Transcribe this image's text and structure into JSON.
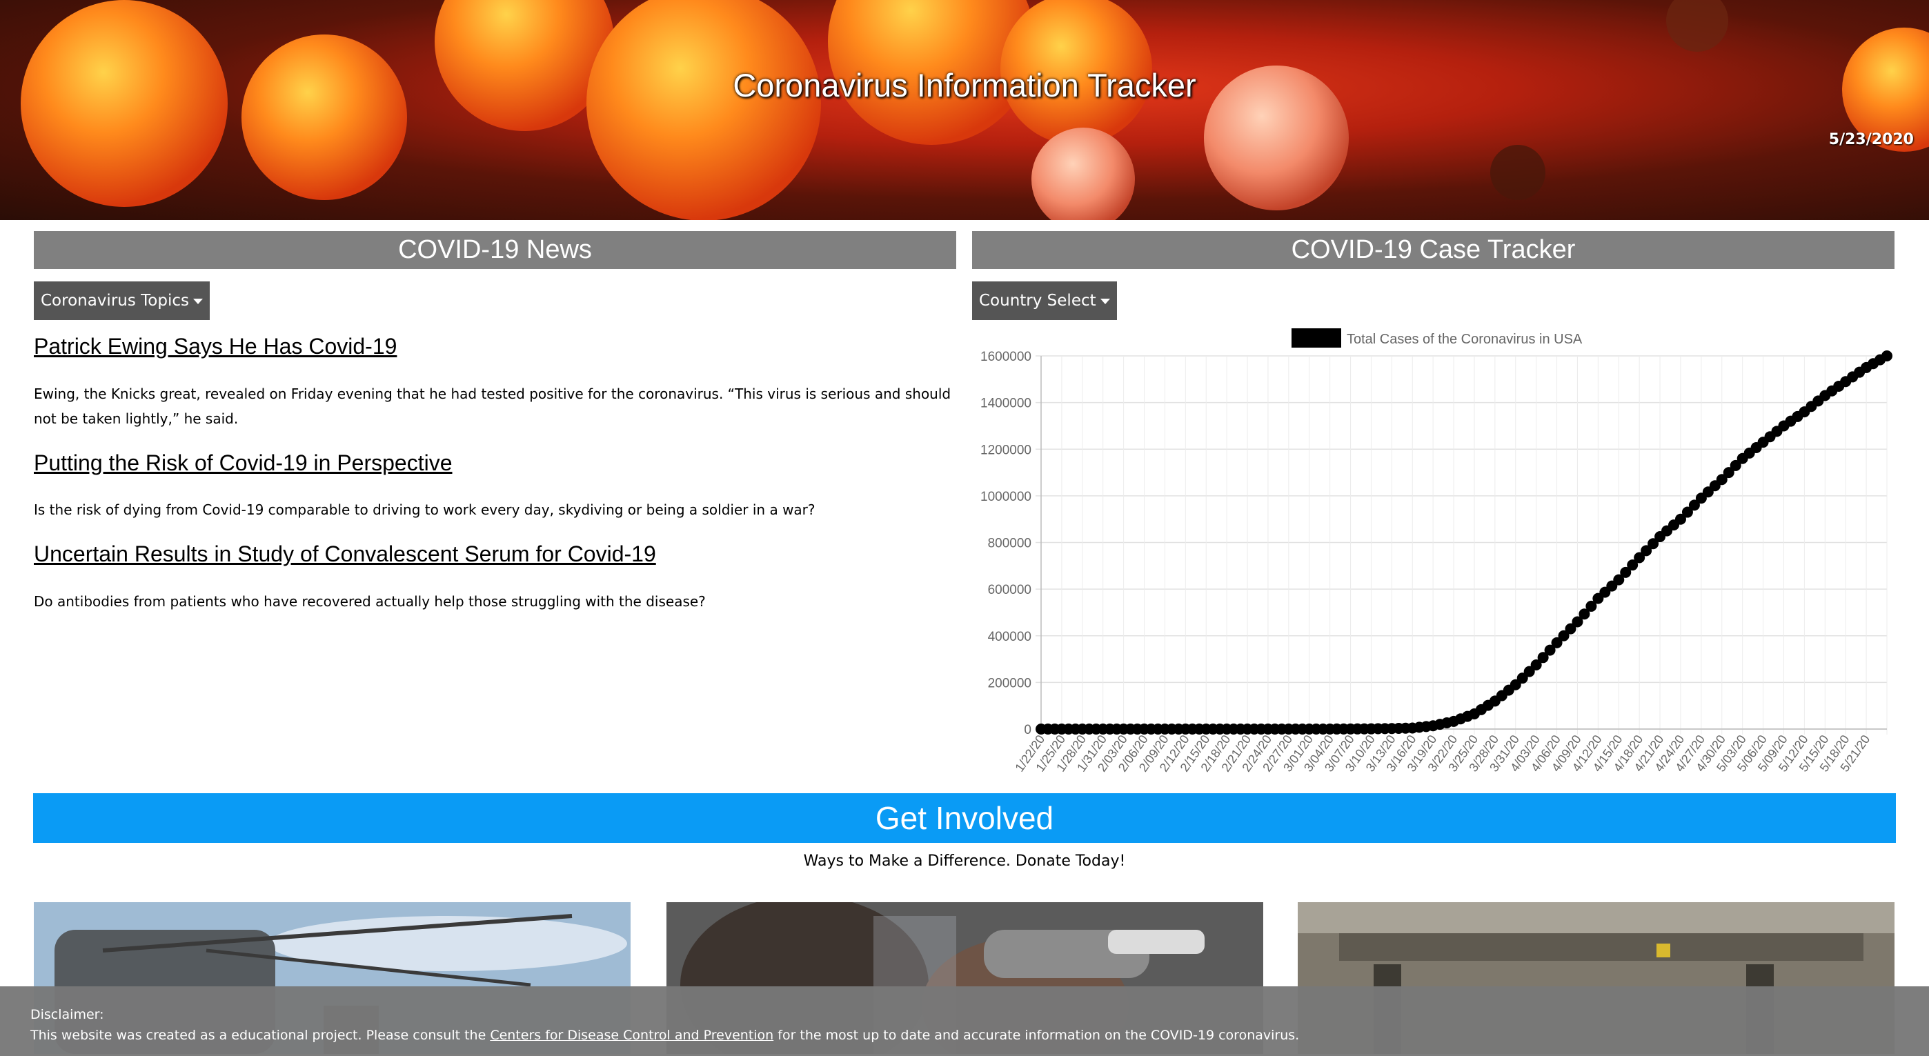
{
  "header": {
    "title": "Coronavirus Information Tracker",
    "date": "5/23/2020"
  },
  "news": {
    "heading": "COVID-19 News",
    "dropdown_label": "Coronavirus Topics",
    "articles": [
      {
        "title": "Patrick Ewing Says He Has Covid-19",
        "description": "Ewing, the Knicks great, revealed on Friday evening that he had tested positive for the coronavirus. “This virus is serious and should not be taken lightly,” he said."
      },
      {
        "title": "Putting the Risk of Covid-19 in Perspective",
        "description": "Is the risk of dying from Covid-19 comparable to driving to work every day, skydiving or being a soldier in a war?"
      },
      {
        "title": "Uncertain Results in Study of Convalescent Serum for Covid-19",
        "description": "Do antibodies from patients who have recovered actually help those struggling with the disease?"
      }
    ]
  },
  "tracker": {
    "heading": "COVID-19 Case Tracker",
    "dropdown_label": "Country Select"
  },
  "chart_data": {
    "type": "line",
    "legend": "Total Cases of the Coronavirus in USA",
    "legend_position": "top",
    "series_color": "#000000",
    "grid": true,
    "ylim": [
      0,
      1600000
    ],
    "yticks": [
      0,
      200000,
      400000,
      600000,
      800000,
      1000000,
      1200000,
      1400000,
      1600000
    ],
    "ytick_labels": [
      "0",
      "200000",
      "400000",
      "600000",
      "800000",
      "1000000",
      "1200000",
      "1400000",
      "1600000"
    ],
    "xtick_labels": [
      "1/22/20",
      "1/25/20",
      "1/28/20",
      "1/31/20",
      "2/03/20",
      "2/06/20",
      "2/09/20",
      "2/12/20",
      "2/15/20",
      "2/18/20",
      "2/21/20",
      "2/24/20",
      "2/27/20",
      "3/01/20",
      "3/04/20",
      "3/07/20",
      "3/10/20",
      "3/13/20",
      "3/16/20",
      "3/19/20",
      "3/22/20",
      "3/25/20",
      "3/28/20",
      "3/31/20",
      "4/03/20",
      "4/06/20",
      "4/09/20",
      "4/12/20",
      "4/15/20",
      "4/18/20",
      "4/21/20",
      "4/24/20",
      "4/27/20",
      "4/30/20",
      "5/03/20",
      "5/06/20",
      "5/09/20",
      "5/12/20",
      "5/15/20",
      "5/18/20",
      "5/21/20"
    ],
    "x": [
      "1/22/20",
      "1/25/20",
      "1/28/20",
      "1/31/20",
      "2/03/20",
      "2/06/20",
      "2/09/20",
      "2/12/20",
      "2/15/20",
      "2/18/20",
      "2/21/20",
      "2/24/20",
      "2/27/20",
      "3/01/20",
      "3/04/20",
      "3/07/20",
      "3/10/20",
      "3/13/20",
      "3/16/20",
      "3/19/20",
      "3/22/20",
      "3/25/20",
      "3/28/20",
      "3/31/20",
      "4/03/20",
      "4/06/20",
      "4/09/20",
      "4/12/20",
      "4/15/20",
      "4/18/20",
      "4/21/20",
      "4/24/20",
      "4/27/20",
      "4/30/20",
      "5/03/20",
      "5/06/20",
      "5/09/20",
      "5/12/20",
      "5/15/20",
      "5/18/20",
      "5/21/20",
      "5/22/20"
    ],
    "values": [
      1,
      5,
      5,
      6,
      11,
      11,
      11,
      13,
      13,
      13,
      15,
      15,
      16,
      30,
      150,
      400,
      1000,
      2200,
      4600,
      14000,
      33000,
      65000,
      120000,
      190000,
      275000,
      370000,
      460000,
      560000,
      640000,
      735000,
      825000,
      900000,
      990000,
      1070000,
      1160000,
      1230000,
      1300000,
      1360000,
      1430000,
      1490000,
      1550000,
      1600000
    ]
  },
  "get_involved": {
    "heading": "Get Involved",
    "subheading": "Ways to Make a Difference. Donate Today!"
  },
  "disclaimer": {
    "label": "Disclaimer:",
    "text_before": "This website was created as a educational project. Please consult the ",
    "link_text": "Centers for Disease Control and Prevention",
    "text_after": " for the most up to date and accurate information on the COVID-19 coronavirus."
  }
}
